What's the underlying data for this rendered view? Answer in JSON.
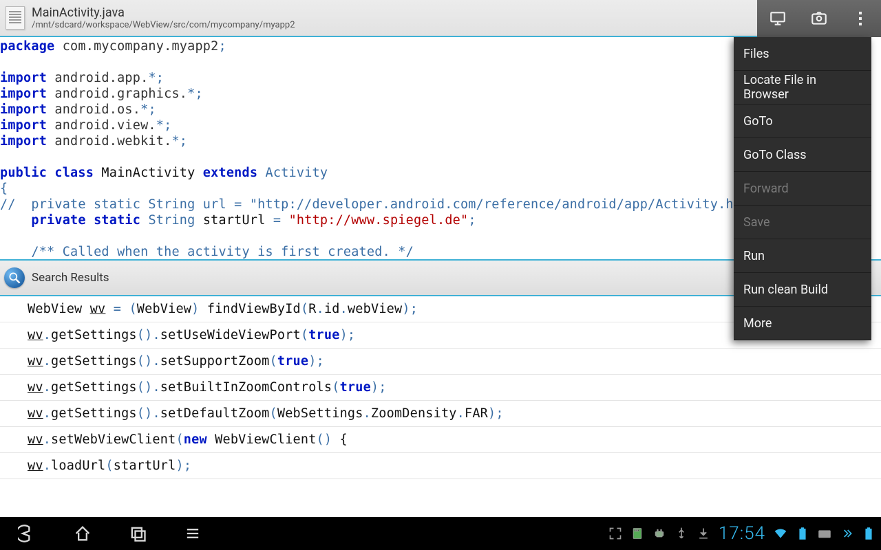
{
  "titlebar": {
    "filename": "MainActivity.java",
    "path": "/mnt/sdcard/workspace/WebView/src/com/mycompany/myapp2"
  },
  "menu": {
    "items": [
      {
        "label": "Files",
        "disabled": false
      },
      {
        "label": "Locate File in Browser",
        "disabled": false
      },
      {
        "label": "GoTo",
        "disabled": false
      },
      {
        "label": "GoTo Class",
        "disabled": false
      },
      {
        "label": "Forward",
        "disabled": true
      },
      {
        "label": "Save",
        "disabled": true
      },
      {
        "label": "Run",
        "disabled": false
      },
      {
        "label": "Run clean Build",
        "disabled": false
      },
      {
        "label": "More",
        "disabled": false
      }
    ]
  },
  "code": {
    "t_package": "package",
    "t_pkgname": " com.mycompany.myapp2",
    "t_semi": ";",
    "t_import": "import",
    "imp1": " android.app.",
    "imp2": " android.graphics.",
    "imp3": " android.os.",
    "imp4": " android.view.",
    "imp5": " android.webkit.",
    "t_star": "*",
    "t_public": "public",
    "t_class": " class ",
    "t_classname": "MainActivity",
    "t_extends": " extends ",
    "t_super": "Activity",
    "t_brace": "{",
    "t_comment1": "//  private static String url = \"http://developer.android.com/reference/android/app/Activity.html",
    "t_indent": "    ",
    "t_private": "private",
    "t_static": " static ",
    "t_String": "String",
    "t_startUrl": " startUrl ",
    "t_eq": "= ",
    "t_urlstr": "\"http://www.spiegel.de\"",
    "t_comment2": "/** Called when the activity is first created. */"
  },
  "search": {
    "label": "Search Results"
  },
  "results": {
    "r0_a": "WebView ",
    "r0_b": "wv",
    "r0_c": " ",
    "r0_eq": "=",
    "r0_d": " ",
    "r0_lp": "(",
    "r0_e": "WebView",
    "r0_rp": ")",
    "r0_f": " findViewById",
    "r0_lp2": "(",
    "r0_g": "R",
    "r0_dot": ".",
    "r0_h": "id",
    "r0_i": "webView",
    "r0_rp2": ")",
    "r0_semi": ";",
    "r1_a": "wv",
    "r1_b": ".",
    "r1_c": "getSettings",
    "r1_d": "()",
    "r1_e": ".",
    "r1_f": "setUseWideViewPort",
    "r1_g": "(",
    "r1_h": "true",
    "r1_i": ")",
    "r1_j": ";",
    "r2_f": "setSupportZoom",
    "r3_f": "setBuiltInZoomControls",
    "r4_f": "setDefaultZoom",
    "r4_arg": "WebSettings",
    "r4_arg2": "ZoomDensity",
    "r4_arg3": "FAR",
    "r5_f": "setWebViewClient",
    "r5_new": "new",
    "r5_cls": " WebViewClient",
    "r5_paren": "()",
    "r5_brace": " {",
    "r6_f": "loadUrl",
    "r6_arg": "startUrl"
  },
  "status": {
    "time": "17:54"
  }
}
